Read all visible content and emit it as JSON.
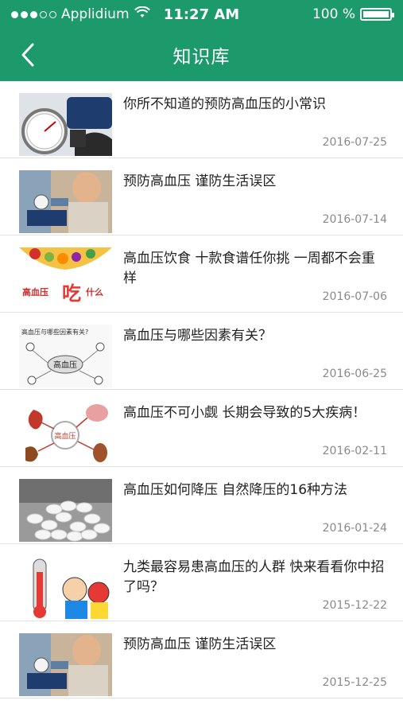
{
  "status_bar": {
    "carrier": "Applidium",
    "time": "11:27 AM",
    "battery": "100 %",
    "battery_level": 1.0,
    "signal_bars_filled": 3,
    "signal_bars_total": 5
  },
  "nav": {
    "title": "知识库",
    "back_icon": "chevron-left-icon"
  },
  "articles": [
    {
      "title": "你所不知道的预防高血压的小常识",
      "date": "2016-07-25",
      "thumb": "blood-pressure-gauge"
    },
    {
      "title": "预防高血压  谨防生活误区",
      "date": "2016-07-14",
      "thumb": "elderly-man-measuring"
    },
    {
      "title": "高血压饮食  十款食谱任你挑 一周都不会重样",
      "date": "2016-07-06",
      "thumb": "food-bowl-what-to-eat",
      "thumb_text_a": "高血压",
      "thumb_text_b": "吃",
      "thumb_text_c": "什么"
    },
    {
      "title": "高血压与哪些因素有关？",
      "date": "2016-06-25",
      "thumb": "causes-diagram",
      "thumb_text_a": "高血压与哪些因素有关?",
      "thumb_text_b": "高血压"
    },
    {
      "title": "高血压不可小觑  长期会导致的5大疾病！",
      "date": "2016-02-11",
      "thumb": "organ-diseases",
      "thumb_text_a": "高血压"
    },
    {
      "title": "高血压如何降压  自然降压的16种方法",
      "date": "2016-01-24",
      "thumb": "white-pills"
    },
    {
      "title": "九类最容易患高血压的人群  快来看看你中招了吗？",
      "date": "2015-12-22",
      "thumb": "thermometer-cartoon"
    },
    {
      "title": "预防高血压  谨防生活误区",
      "date": "2015-12-25",
      "thumb": "elderly-man-measuring"
    }
  ]
}
